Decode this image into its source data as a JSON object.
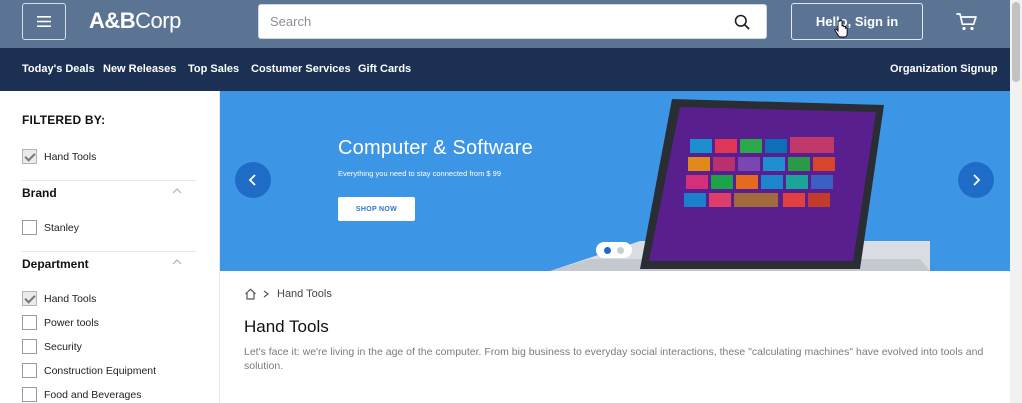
{
  "header": {
    "brand_bold": "A&B",
    "brand_light": "Corp",
    "search_placeholder": "Search",
    "search_icon": "search-icon",
    "signin_label": "Hello, Sign in",
    "cart_icon": "cart-icon",
    "menu_icon": "hamburger-icon",
    "bg_color": "#5c7494"
  },
  "nav": {
    "bg_color": "#1c3053",
    "items": [
      "Today's Deals",
      "New Releases",
      "Top Sales",
      "Costumer Services",
      "Gift Cards"
    ],
    "right_link": "Organization Signup"
  },
  "sidebar": {
    "filter_title": "FILTERED BY:",
    "active_filters": [
      {
        "label": "Hand Tools",
        "checked": true
      }
    ],
    "brand": {
      "title": "Brand",
      "options": [
        {
          "label": "Stanley",
          "checked": false
        }
      ]
    },
    "department": {
      "title": "Department",
      "options": [
        {
          "label": "Hand Tools",
          "checked": true
        },
        {
          "label": "Power tools",
          "checked": false
        },
        {
          "label": "Security",
          "checked": false
        },
        {
          "label": "Construction Equipment",
          "checked": false
        },
        {
          "label": "Food and Beverages",
          "checked": false
        }
      ]
    }
  },
  "hero": {
    "title": "Computer & Software",
    "subtitle": "Everything you need to stay connected from $ 99",
    "cta": "SHOP NOW",
    "bg_color": "#3d95e6",
    "prev_icon": "chevron-left-icon",
    "next_icon": "chevron-right-icon",
    "slides_total": 2,
    "active_slide": 1
  },
  "content": {
    "breadcrumb_home_icon": "home-icon",
    "breadcrumb_current": "Hand Tools",
    "page_title": "Hand Tools",
    "description": "Let's face it: we're living in the age of the computer. From big business to everyday social interactions, these \"calculating machines\" have evolved into tools and solution."
  }
}
